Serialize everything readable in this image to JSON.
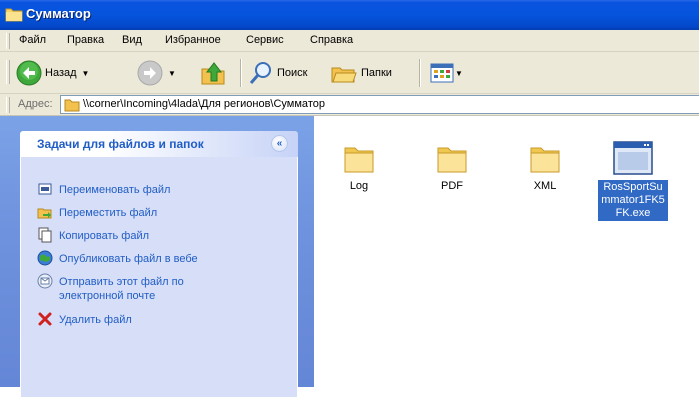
{
  "window": {
    "title": "Сумматор"
  },
  "menu": {
    "items": [
      "Файл",
      "Правка",
      "Вид",
      "Избранное",
      "Сервис",
      "Справка"
    ]
  },
  "toolbar": {
    "back_label": "Назад",
    "search_label": "Поиск",
    "folders_label": "Папки"
  },
  "address": {
    "label": "Адрес:",
    "value": "\\\\corner\\Incoming\\4lada\\Для регионов\\Сумматор"
  },
  "tasks": {
    "title": "Задачи для файлов и папок",
    "items": [
      {
        "label": "Переименовать файл",
        "icon": "rename-icon"
      },
      {
        "label": "Переместить файл",
        "icon": "move-icon"
      },
      {
        "label": "Копировать файл",
        "icon": "copy-icon"
      },
      {
        "label": "Опубликовать файл в вебе",
        "icon": "publish-web-icon"
      },
      {
        "label": "Отправить этот файл по электронной почте",
        "icon": "email-icon"
      },
      {
        "label": "Удалить файл",
        "icon": "delete-icon"
      }
    ]
  },
  "files": [
    {
      "name": "Log",
      "type": "folder"
    },
    {
      "name": "PDF",
      "type": "folder"
    },
    {
      "name": "XML",
      "type": "folder"
    },
    {
      "name": "RosSportSummator1FK5FK.exe",
      "type": "exe",
      "selected": true
    }
  ],
  "colors": {
    "title_bar": "#0554dc",
    "task_link": "#215dc6",
    "selection": "#316ac5",
    "pane_bg": "#6f93de"
  }
}
